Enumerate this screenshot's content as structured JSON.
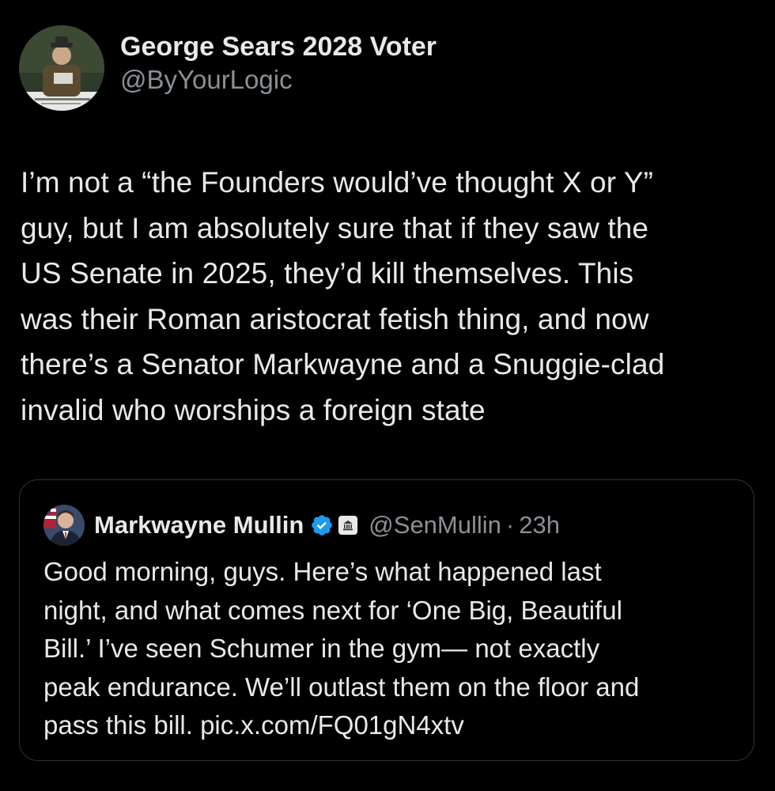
{
  "author": {
    "display_name": "George Sears 2028 Voter",
    "handle": "@ByYourLogic",
    "avatar_icon": "profile-photo"
  },
  "tweet": {
    "lines": [
      "I’m not a “the Founders would’ve thought X or Y”",
      "guy, but I am absolutely sure that if they saw the",
      "US Senate in 2025, they’d kill themselves. This",
      "was their Roman aristocrat fetish thing, and now",
      "there’s a Senator Markwayne and a Snuggie-clad",
      "invalid who worships a foreign state"
    ]
  },
  "quote": {
    "display_name": "Markwayne Mullin",
    "handle": "@SenMullin",
    "separator": "·",
    "time": "23h",
    "verified_icon": "verified-badge-icon",
    "affiliation_icon": "government-building-icon",
    "lines": [
      "Good morning, guys. Here’s what happened last",
      "night, and what comes next for ‘One Big, Beautiful",
      "Bill.’ I’ve seen Schumer in the gym— not exactly",
      "peak endurance. We’ll outlast them on the floor and",
      "pass this bill. pic.x.com/FQ01gN4xtv"
    ]
  },
  "colors": {
    "background": "#000000",
    "text_primary": "#e7e9ea",
    "text_secondary": "#8b9096",
    "verified_blue": "#1d9bf0",
    "card_border": "#2f3336"
  }
}
